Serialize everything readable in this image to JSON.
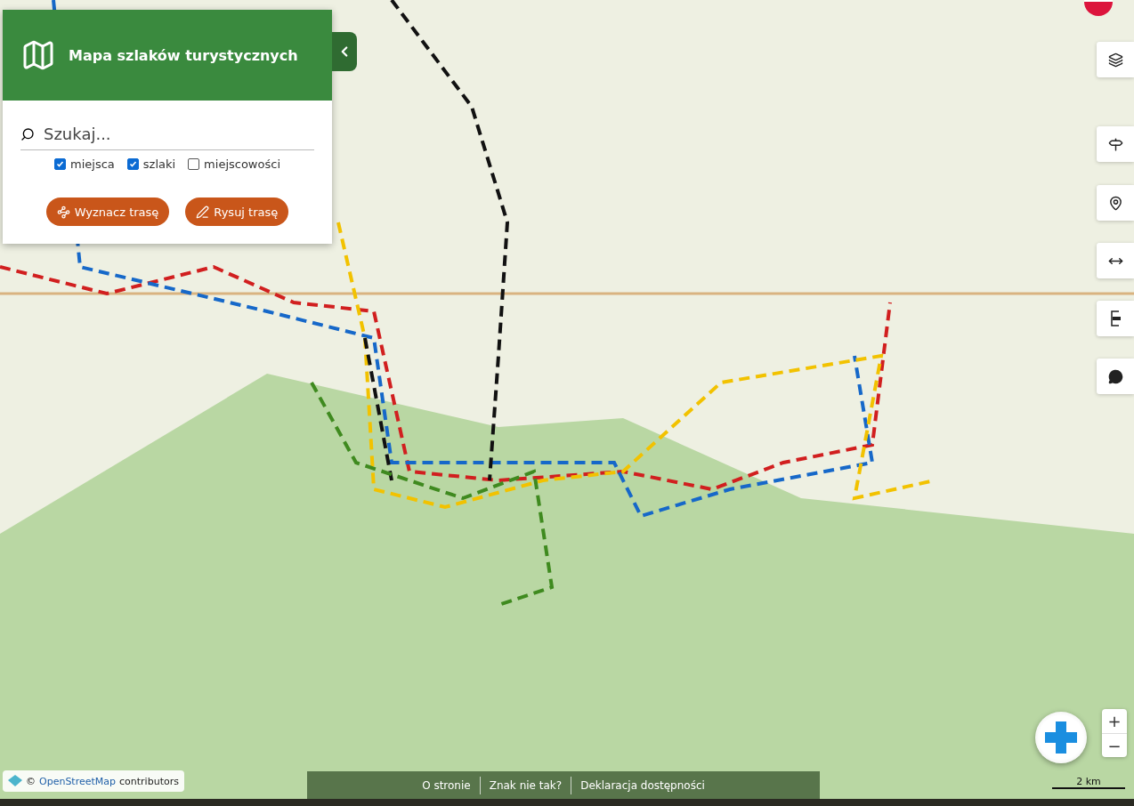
{
  "panel": {
    "title": "Mapa szlaków turystycznych",
    "search": {
      "placeholder": "Szukaj..."
    },
    "filters": [
      {
        "label": "miejsca",
        "checked": true
      },
      {
        "label": "szlaki",
        "checked": true
      },
      {
        "label": "miejscowości",
        "checked": false
      }
    ],
    "buttons": [
      {
        "kind": "route",
        "label": "Wyznacz trasę"
      },
      {
        "kind": "draw",
        "label": "Rysuj trasę"
      }
    ]
  },
  "map_tools": [
    {
      "kind": "layers"
    },
    {
      "kind": "signpost"
    },
    {
      "kind": "pin"
    },
    {
      "kind": "measure"
    },
    {
      "kind": "gpx"
    },
    {
      "kind": "chat"
    }
  ],
  "zoom": {
    "in": "+",
    "out": "−"
  },
  "scale": "2 km",
  "attribution": {
    "prefix": "©",
    "link": "OpenStreetMap",
    "suffix": "contributors"
  },
  "footer_links": [
    "O stronie",
    "Znak nie tak?",
    "Deklaracja dostępności"
  ]
}
